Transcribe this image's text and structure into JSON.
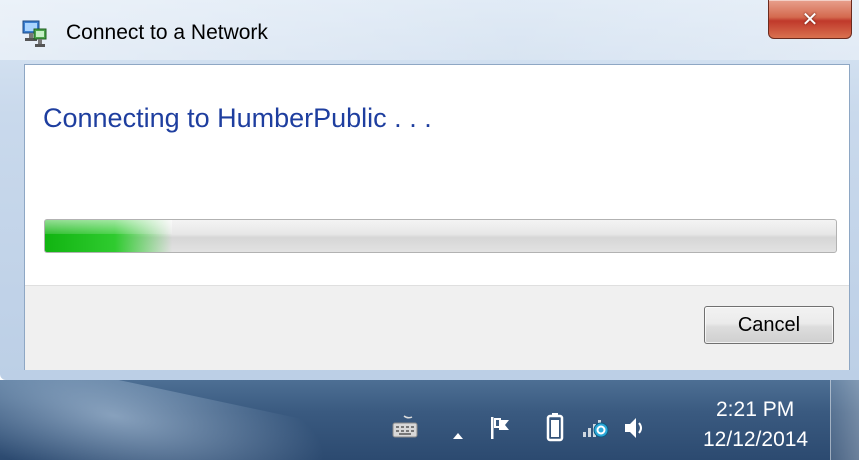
{
  "window": {
    "title": "Connect to a Network",
    "close_icon": "close-icon",
    "app_icon": "network-connect-icon"
  },
  "dialog": {
    "heading": "Connecting to HumberPublic . . .",
    "progress": 0.16,
    "cancel_label": "Cancel"
  },
  "taskbar": {
    "tray_icons": [
      "keyboard-icon",
      "show-hidden-icons-arrow",
      "action-center-flag-icon",
      "battery-icon",
      "network-icon",
      "volume-icon"
    ],
    "time": "2:21 PM",
    "date": "12/12/2014"
  },
  "colors": {
    "heading": "#1e3e9f",
    "progress_fill": "#22c022",
    "close_button": "#c0392b",
    "taskbar": "#3a5a80"
  }
}
